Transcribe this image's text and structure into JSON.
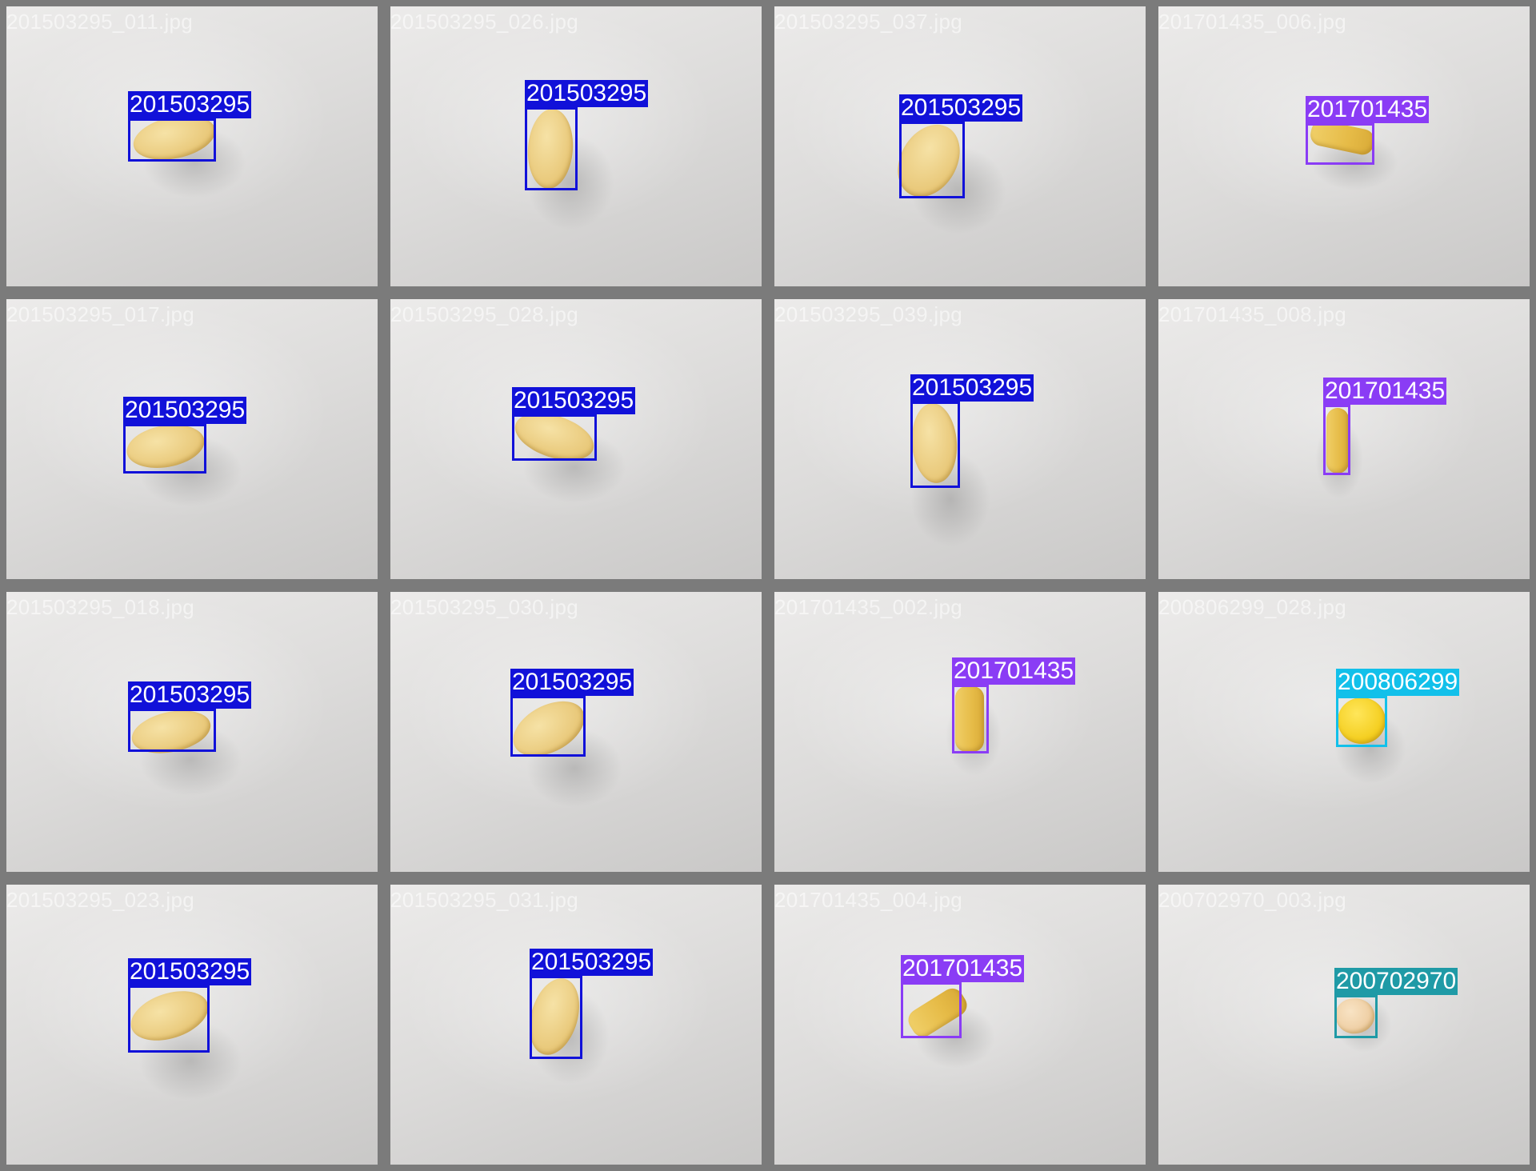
{
  "colors": {
    "201503295": "#1111d9",
    "201701435": "#8a3cf5",
    "200806299": "#12c0ea",
    "200702970": "#1f9aa6"
  },
  "tiles": [
    {
      "filename": "201503295_011.jpg",
      "label": "201503295",
      "pill": "oval"
    },
    {
      "filename": "201503295_026.jpg",
      "label": "201503295",
      "pill": "oval"
    },
    {
      "filename": "201503295_037.jpg",
      "label": "201503295",
      "pill": "oval"
    },
    {
      "filename": "201701435_006.jpg",
      "label": "201701435",
      "pill": "capsule"
    },
    {
      "filename": "201503295_017.jpg",
      "label": "201503295",
      "pill": "oval"
    },
    {
      "filename": "201503295_028.jpg",
      "label": "201503295",
      "pill": "oval"
    },
    {
      "filename": "201503295_039.jpg",
      "label": "201503295",
      "pill": "oval"
    },
    {
      "filename": "201701435_008.jpg",
      "label": "201701435",
      "pill": "capsule"
    },
    {
      "filename": "201503295_018.jpg",
      "label": "201503295",
      "pill": "oval"
    },
    {
      "filename": "201503295_030.jpg",
      "label": "201503295",
      "pill": "oval"
    },
    {
      "filename": "201701435_002.jpg",
      "label": "201701435",
      "pill": "capsule"
    },
    {
      "filename": "200806299_028.jpg",
      "label": "200806299",
      "pill": "round"
    },
    {
      "filename": "201503295_023.jpg",
      "label": "201503295",
      "pill": "oval"
    },
    {
      "filename": "201503295_031.jpg",
      "label": "201503295",
      "pill": "oval"
    },
    {
      "filename": "201701435_004.jpg",
      "label": "201701435",
      "pill": "capsule"
    },
    {
      "filename": "200702970_003.jpg",
      "label": "200702970",
      "pill": "small"
    }
  ]
}
